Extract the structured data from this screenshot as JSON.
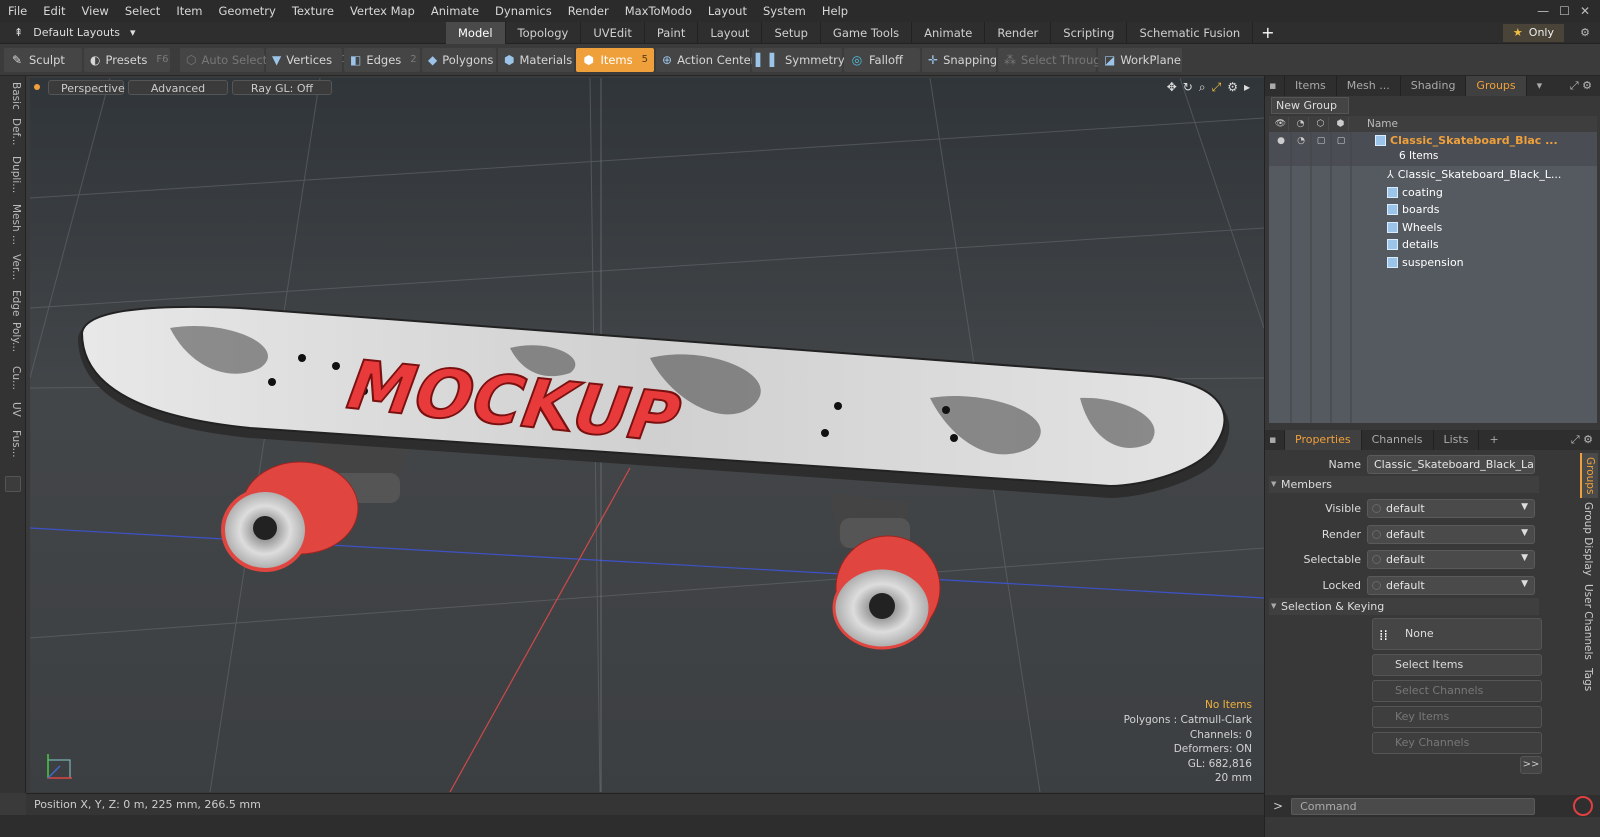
{
  "menu": [
    "File",
    "Edit",
    "View",
    "Select",
    "Item",
    "Geometry",
    "Texture",
    "Vertex Map",
    "Animate",
    "Dynamics",
    "Render",
    "MaxToModo",
    "Layout",
    "System",
    "Help"
  ],
  "layouts": {
    "label": "Default Layouts"
  },
  "layout_tabs": [
    "Model",
    "Topology",
    "UVEdit",
    "Paint",
    "Layout",
    "Setup",
    "Game Tools",
    "Animate",
    "Render",
    "Scripting",
    "Schematic Fusion"
  ],
  "active_tab": "Model",
  "only_label": "Only",
  "toolbar": {
    "sculpt": "Sculpt",
    "presets": "Presets",
    "presets_key": "F6",
    "auto_select": "Auto Select",
    "vertices": "Vertices",
    "vertices_key": "1",
    "edges": "Edges",
    "edges_key": "2",
    "polygons": "Polygons",
    "materials": "Materials",
    "items": "Items",
    "items_key": "5",
    "action_center": "Action Center",
    "symmetry": "Symmetry",
    "falloff": "Falloff",
    "snapping": "Snapping",
    "select_through": "Select Through",
    "workplane": "WorkPlane"
  },
  "left_tabs": [
    "Basic",
    "Def...",
    "Dupli...",
    "Mesh ...",
    "Ver...",
    "Edge",
    "Poly...",
    "Cu...",
    "UV",
    "Fus..."
  ],
  "viewport": {
    "perspective": "Perspective",
    "advanced": "Advanced",
    "raygl": "Ray GL: Off",
    "logo_text": "MOCKUP",
    "info": {
      "no_items": "No Items",
      "polygons": "Polygons : Catmull-Clark",
      "channels": "Channels: 0",
      "deformers": "Deformers: ON",
      "gl": "GL: 682,816",
      "scale": "20 mm"
    }
  },
  "status": {
    "position": "Position X, Y, Z:   0 m, 225 mm, 266.5 mm"
  },
  "panel_tabs": [
    "Items",
    "Mesh ...",
    "Shading",
    "Groups"
  ],
  "active_panel_tab": "Groups",
  "groups": {
    "new_group": "New Group",
    "col_name": "Name",
    "group_name": "Classic_Skateboard_Blac ...",
    "group_count": "6 Items",
    "children": [
      "Classic_Skateboard_Black_L...",
      "coating",
      "boards",
      "Wheels",
      "details",
      "suspension"
    ]
  },
  "props_tabs": [
    "Properties",
    "Channels",
    "Lists"
  ],
  "properties": {
    "name_label": "Name",
    "name_value": "Classic_Skateboard_Black_Label (",
    "members": "Members",
    "visible_label": "Visible",
    "visible": "default",
    "render_label": "Render",
    "render": "default",
    "selectable_label": "Selectable",
    "selectable": "default",
    "locked_label": "Locked",
    "locked": "default",
    "selection_keying": "Selection & Keying",
    "none": "None",
    "select_items": "Select Items",
    "select_channels": "Select Channels",
    "key_items": "Key Items",
    "key_channels": "Key Channels"
  },
  "side_tabs": [
    "Groups",
    "Group Display",
    "User Channels",
    "Tags"
  ],
  "command": {
    "placeholder": "Command"
  },
  "colors": {
    "accent": "#f0a03a",
    "wheel": "#e0463f",
    "logo": "#e83a3a"
  }
}
